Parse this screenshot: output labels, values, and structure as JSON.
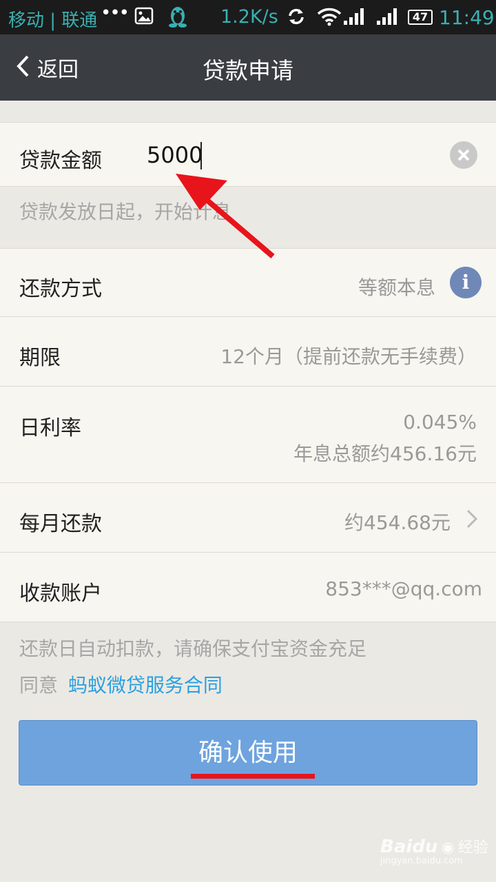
{
  "status_bar": {
    "carrier": "移动 | 联通",
    "dots": "•••",
    "net_speed": "1.2K/s",
    "battery": "47",
    "time": "11:49",
    "icons": [
      "image-icon",
      "qq-penguin-icon",
      "sync-icon",
      "wifi-icon",
      "signal-icon",
      "signal-icon",
      "battery-icon"
    ]
  },
  "nav": {
    "back_label": "返回",
    "title": "贷款申请"
  },
  "amount": {
    "label": "贷款金额",
    "value": "5000"
  },
  "interest_note": "贷款发放日起，开始计息",
  "repay_method": {
    "label": "还款方式",
    "value": "等额本息"
  },
  "term": {
    "label": "期限",
    "value": "12个月（提前还款无手续费）"
  },
  "daily_rate": {
    "label": "日利率",
    "value": "0.045%",
    "sub": "年息总额约456.16元"
  },
  "monthly": {
    "label": "每月还款",
    "value": "约454.68元"
  },
  "account": {
    "label": "收款账户",
    "value": "853***@qq.com"
  },
  "footer": {
    "auto_debit": "还款日自动扣款，请确保支付宝资金充足",
    "agree_prefix": "同意",
    "contract_link": "蚂蚁微贷服务合同"
  },
  "confirm_label": "确认使用",
  "watermark": {
    "brand": "Baidu",
    "sub_brand": "经验",
    "url": "jingyan.baidu.com"
  },
  "colors": {
    "link": "#2aa0e0",
    "button": "#6ea3de",
    "annotation": "#e8141b"
  }
}
